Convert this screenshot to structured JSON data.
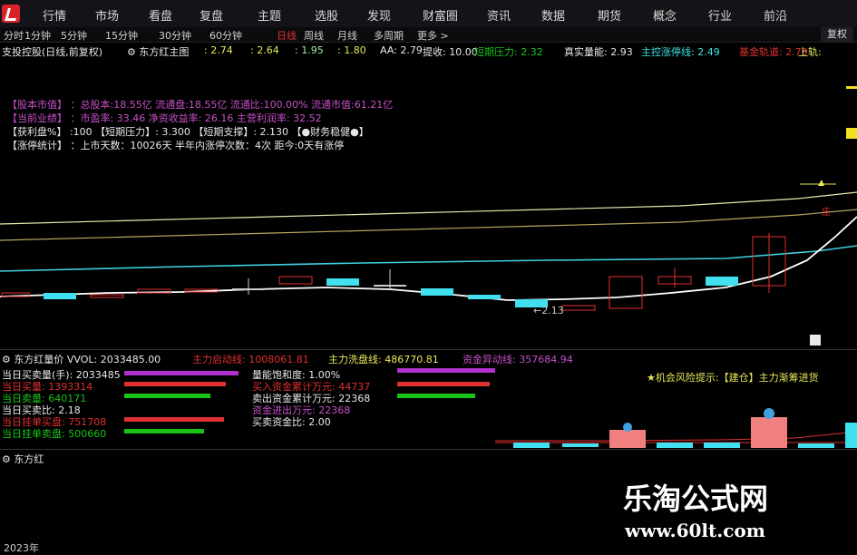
{
  "menu": [
    "行情",
    "市场",
    "看盘",
    "复盘",
    "主题",
    "选股",
    "发现",
    "财富圈",
    "资讯",
    "数据",
    "期货",
    "概念",
    "行业",
    "前沿"
  ],
  "periods": [
    "分时",
    "1分钟",
    "5分钟",
    "15分钟",
    "30分钟",
    "60分钟",
    "日线",
    "周线",
    "月线",
    "多周期",
    "更多 >"
  ],
  "active_period": "日线",
  "fuquan_label": "复权",
  "main_title": "支投控股(日线,前复权)",
  "dfh_main_label": "东方红主图",
  "indicators": [
    {
      "label": ": 2.74",
      "color": "#e8e85a"
    },
    {
      "label": ": 2.64",
      "color": "#e8e85a"
    },
    {
      "label": ": 1.95",
      "color": "#9ff09f"
    },
    {
      "label": ": 1.80",
      "color": "#e8e85a"
    },
    {
      "label": "AA: 2.79",
      "color": "#e8e8e8"
    },
    {
      "label": "提收: 10.00",
      "color": "#e8e8e8"
    },
    {
      "label": "短期压力: 2.32",
      "color": "#19c419"
    },
    {
      "label": "真实量能: 2.93",
      "color": "#e8e8e8"
    },
    {
      "label": "主控涨停线: 2.49",
      "color": "#40e0e0"
    },
    {
      "label": "基金轨道: 2.79",
      "color": "#e03030"
    },
    {
      "label": "上轨:",
      "color": "#e8e85a"
    }
  ],
  "info_lines": [
    {
      "text": "【股本市值】 ：总股本:18.55亿 流通盘:18.55亿 流通比:100.00% 流通市值:61.21亿",
      "color": "#c850c8"
    },
    {
      "text": "【当前业绩】 ：市盈率: 33.46 净资收益率: 26.16 主营利润率: 32.52",
      "color": "#c850c8"
    },
    {
      "text": "【获利盘%】 :100  【短期压力】: 3.300  【短期支撑】: 2.130  【●财务稳健●】",
      "color": "#e8e8e8"
    },
    {
      "text": "【涨停统计】 ：上市天数：10026天 半年内涨停次数：4次  距今:0天有涨停",
      "color": "#e8e8e8"
    }
  ],
  "price_annotation": "←2.13",
  "vol_panel": {
    "title": "东方红量价 VVOL: 2033485.00",
    "main_cost": "主力启动线: 1008061.81",
    "main_wash": "主力洗盘线: 486770.81",
    "fund_line": "资金异动线: 357684.94",
    "left_stats": [
      {
        "text": "当日买卖量(手): 2033485",
        "color": "#e8e8e8"
      },
      {
        "text": "当日买量: 1393314",
        "color": "#e03030"
      },
      {
        "text": "当日卖量: 640171",
        "color": "#19c419"
      },
      {
        "text": "当日买卖比: 2.18",
        "color": "#e8e8e8"
      },
      {
        "text": "当日挂单买盘: 751708",
        "color": "#e03030"
      },
      {
        "text": "当日挂单卖盘: 500660",
        "color": "#19c419"
      }
    ],
    "mid_stats": [
      {
        "text": "量能饱和度: 1.00%",
        "color": "#e8e8e8"
      },
      {
        "text": "买入资金累计万元: 44737",
        "color": "#e03030"
      },
      {
        "text": "卖出资金累计万元: 22368",
        "color": "#e8e8e8"
      },
      {
        "text": "资金进出万元: 22368",
        "color": "#c850c8"
      },
      {
        "text": "买卖资金比: 2.00",
        "color": "#e8e8e8"
      }
    ],
    "hint": "★机会风险提示:【建仓】主力渐筹进货"
  },
  "dfh_panel_title": "东方红",
  "year_label": "2023年",
  "watermark": {
    "title": "乐淘公式网",
    "url": "www.60lt.com"
  }
}
